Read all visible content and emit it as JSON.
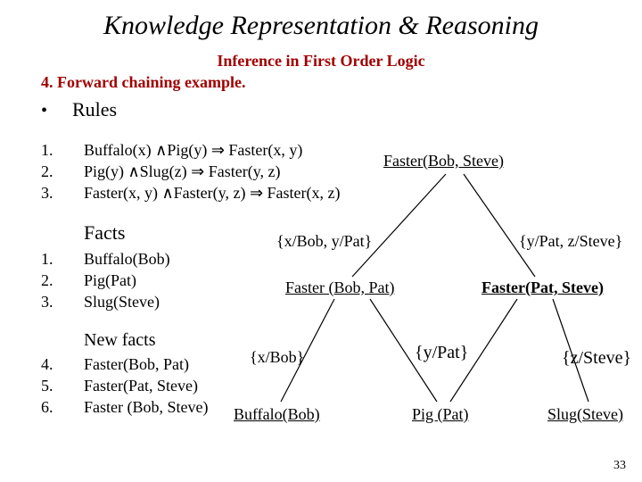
{
  "title": "Knowledge Representation & Reasoning",
  "subtitle": "Inference in First Order Logic",
  "section": "4. Forward chaining example.",
  "rules_heading": "Rules",
  "rules": [
    {
      "n": "1.",
      "text": "Buffalo(x) ∧Pig(y) ⇒ Faster(x, y)"
    },
    {
      "n": "2.",
      "text": "Pig(y) ∧Slug(z) ⇒ Faster(y, z)"
    },
    {
      "n": "3.",
      "text": "Faster(x, y) ∧Faster(y, z) ⇒ Faster(x, z)"
    }
  ],
  "facts_heading": "Facts",
  "facts": [
    {
      "n": "1.",
      "text": "Buffalo(Bob)"
    },
    {
      "n": "2.",
      "text": "Pig(Pat)"
    },
    {
      "n": "3.",
      "text": "Slug(Steve)"
    }
  ],
  "newfacts_heading": "New facts",
  "newfacts": [
    {
      "n": "4.",
      "text": "Faster(Bob, Pat)"
    },
    {
      "n": "5.",
      "text": "Faster(Pat, Steve)"
    },
    {
      "n": "6.",
      "text": "Faster (Bob, Steve)"
    }
  ],
  "tree": {
    "root": "Faster(Bob, Steve)",
    "unify_left": "{x/Bob, y/Pat}",
    "unify_right": "{y/Pat, z/Steve}",
    "mid_left": "Faster (Bob, Pat)",
    "mid_right": "Faster(Pat, Steve)",
    "subst_left": "{x/Bob}",
    "subst_center": "{y/Pat}",
    "subst_right": "{z/Steve}",
    "leaf_left": "Buffalo(Bob)",
    "leaf_center": "Pig (Pat)",
    "leaf_right": "Slug(Steve)"
  },
  "slide_number": "33"
}
